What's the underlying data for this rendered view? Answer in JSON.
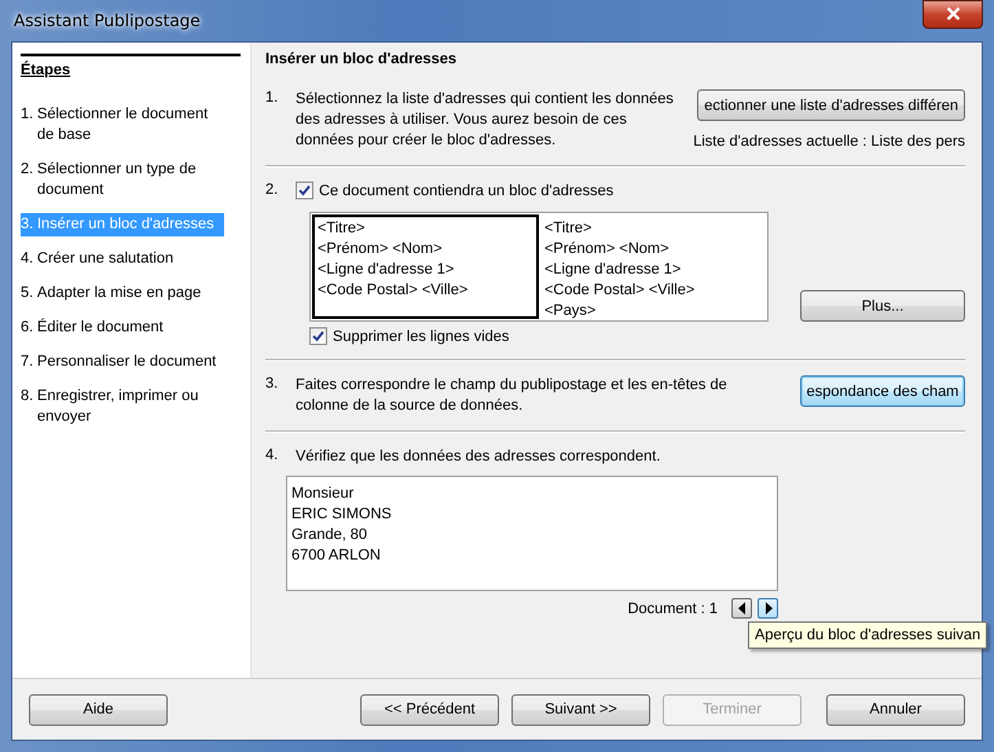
{
  "window": {
    "title": "Assistant Publipostage"
  },
  "sidebar": {
    "heading": "Étapes",
    "items": [
      {
        "number": "1.",
        "label": "Sélectionner le document de base",
        "selected": false
      },
      {
        "number": "2.",
        "label": "Sélectionner un type de document",
        "selected": false
      },
      {
        "number": "3.",
        "label": "Insérer un bloc d'adresses",
        "selected": true
      },
      {
        "number": "4.",
        "label": "Créer une salutation",
        "selected": false
      },
      {
        "number": "5.",
        "label": "Adapter la mise en page",
        "selected": false
      },
      {
        "number": "6.",
        "label": "Éditer le document",
        "selected": false
      },
      {
        "number": "7.",
        "label": "Personnaliser le document",
        "selected": false
      },
      {
        "number": "8.",
        "label": "Enregistrer, imprimer ou envoyer",
        "selected": false
      }
    ]
  },
  "main": {
    "title": "Insérer un bloc d'adresses",
    "step1": {
      "number": "1.",
      "text": "Sélectionnez la liste d'adresses qui contient les données des adresses à utiliser. Vous aurez besoin de ces données pour créer le bloc d'adresses.",
      "button": "ectionner une liste d'adresses différen",
      "current_list": "Liste d'adresses actuelle : Liste des pers"
    },
    "step2": {
      "number": "2.",
      "checkbox": {
        "label": "Ce document contiendra un bloc d'adresses",
        "checked": true
      },
      "blocks": [
        {
          "lines": [
            "<Titre>",
            "<Prénom>  <Nom>",
            "<Ligne d'adresse 1>",
            "<Code Postal>  <Ville>"
          ],
          "selected": true
        },
        {
          "lines": [
            "<Titre>",
            "<Prénom>  <Nom>",
            "<Ligne d'adresse 1>",
            "<Code Postal>  <Ville>",
            "<Pays>"
          ],
          "selected": false
        }
      ],
      "more_button": "Plus...",
      "suppress": {
        "label": "Supprimer les lignes vides",
        "checked": true
      }
    },
    "step3": {
      "number": "3.",
      "text": "Faites correspondre le champ du publipostage et les en-têtes de colonne de la source de données.",
      "button": "espondance des cham"
    },
    "step4": {
      "number": "4.",
      "text": "Vérifiez que les données des adresses correspondent.",
      "preview": [
        "Monsieur",
        "ERIC SIMONS",
        "Grande, 80",
        "6700 ARLON"
      ],
      "document_label": "Document : 1",
      "tooltip": "Aperçu du bloc d'adresses suivan"
    }
  },
  "buttons": [
    {
      "label": "Aide",
      "disabled": false
    },
    {
      "label": "<< Précédent",
      "disabled": false
    },
    {
      "label": "Suivant >>",
      "disabled": false
    },
    {
      "label": "Terminer",
      "disabled": true
    },
    {
      "label": "Annuler",
      "disabled": false
    }
  ]
}
